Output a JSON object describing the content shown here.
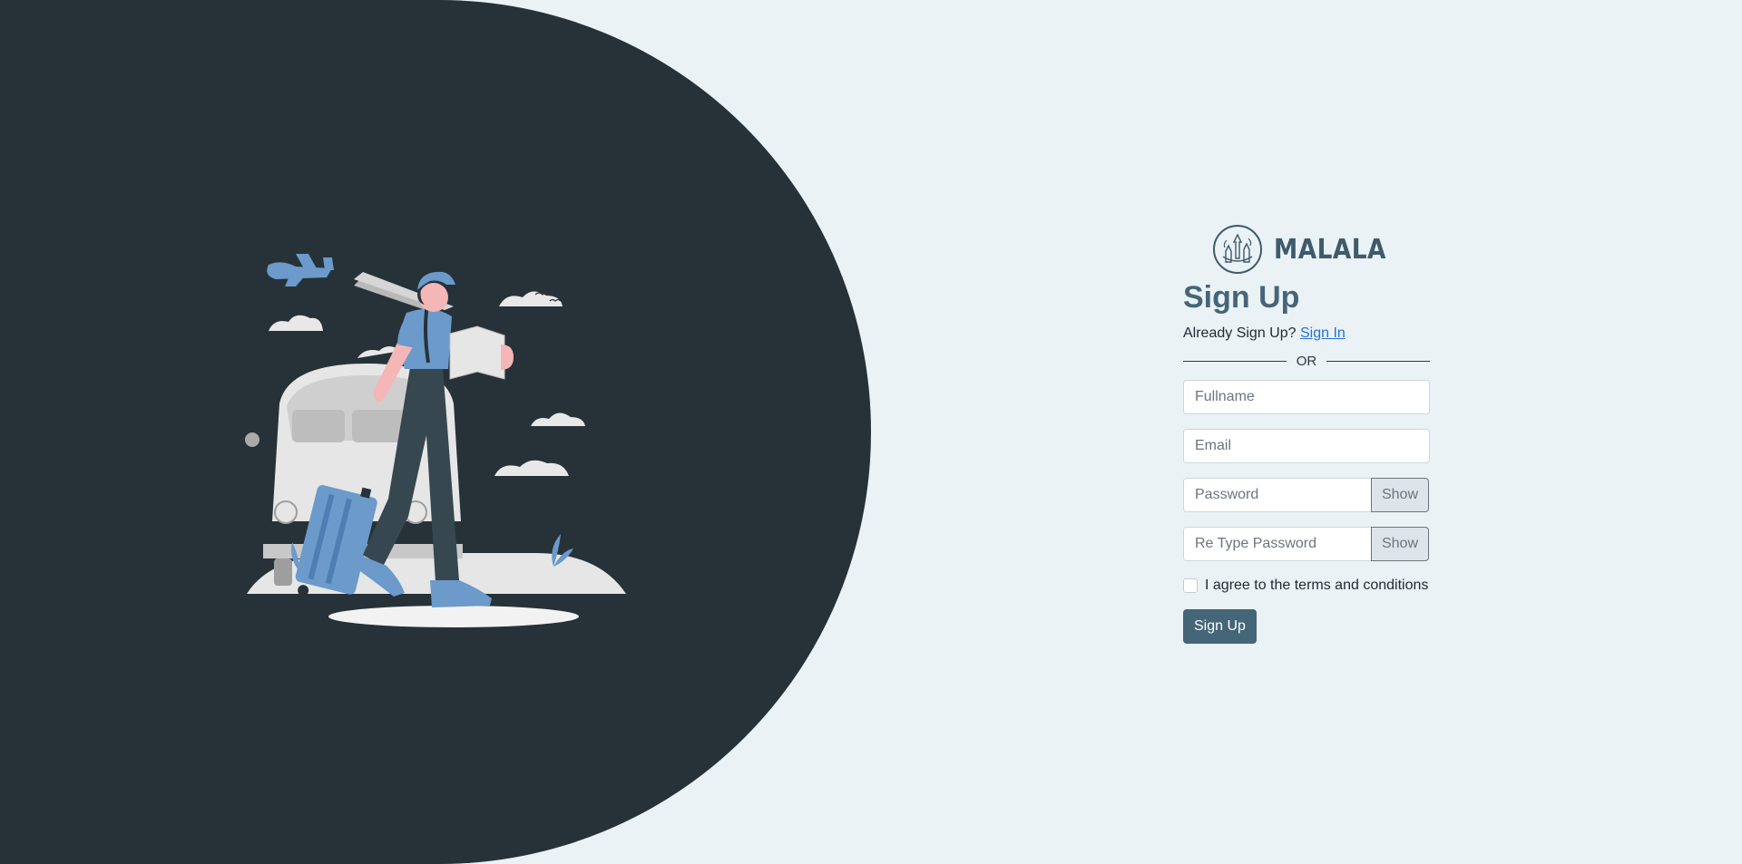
{
  "brand": {
    "name": "MALALA",
    "logo_icon": "travel-landmarks-logo-icon"
  },
  "illustration": {
    "icon": "traveler-with-van-illustration"
  },
  "form": {
    "title": "Sign Up",
    "already_text": "Already Sign Up?",
    "signin_link": "Sign In",
    "divider_text": "OR",
    "fullname_placeholder": "Fullname",
    "email_placeholder": "Email",
    "password_placeholder": "Password",
    "retype_placeholder": "Re Type Password",
    "show_label": "Show",
    "terms_label": "I agree to the terms and conditions",
    "submit_label": "Sign Up"
  },
  "colors": {
    "left_panel": "#263238",
    "background": "#eaf2f6",
    "accent": "#456578",
    "link": "#2a6fd6"
  }
}
